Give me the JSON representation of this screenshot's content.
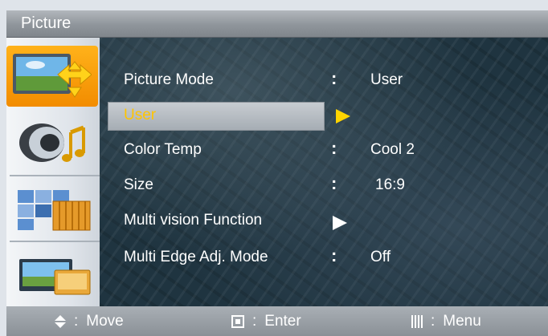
{
  "window": {
    "title": "Picture"
  },
  "sidebar": {
    "items": [
      {
        "icon": "picture-move-icon",
        "selected": true
      },
      {
        "icon": "sound-speaker-icon",
        "selected": false
      },
      {
        "icon": "multi-screen-icon",
        "selected": false
      },
      {
        "icon": "monitor-setup-icon",
        "selected": false
      }
    ]
  },
  "menu": {
    "rows": [
      {
        "label": "Picture Mode",
        "colon": ":",
        "value": "User"
      },
      {
        "label": "User",
        "highlighted": true
      },
      {
        "label": "Color Temp",
        "colon": ":",
        "value": "Cool 2"
      },
      {
        "label": "Size",
        "colon": ":",
        "value": "16:9"
      },
      {
        "label": "Multi vision Function",
        "submenu": true
      },
      {
        "label": "Multi Edge Adj. Mode",
        "colon": ":",
        "value": "Off"
      }
    ]
  },
  "footer": {
    "move": {
      "icon": "up-down-icon",
      "sep": ":",
      "text": "Move"
    },
    "enter": {
      "icon": "enter-icon",
      "sep": ":",
      "text": "Enter"
    },
    "menu": {
      "icon": "menu-icon",
      "sep": ":",
      "text": "Menu"
    }
  },
  "colors": {
    "highlight_text": "#ffc400",
    "selected_tab": "#f28c00",
    "panel": "#1f3440"
  }
}
